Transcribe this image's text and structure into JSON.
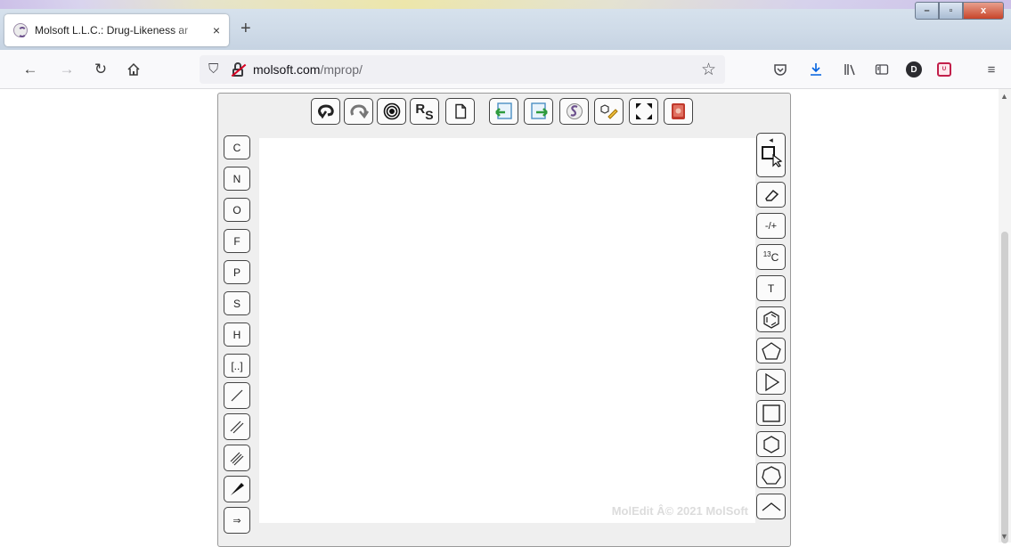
{
  "browser": {
    "tab_title": "Molsoft L.L.C.: Drug-Likeness ar",
    "tab_close": "×",
    "new_tab": "+",
    "url_host": "molsoft.com",
    "url_path": "/mprop/",
    "profile_initial": "D",
    "window_controls": {
      "minimize": "–",
      "maximize": "▫",
      "close": "x"
    }
  },
  "editor": {
    "copyright": "MolEdit Â© 2021 MolSoft",
    "top_toolbar": [
      {
        "name": "undo",
        "icon": "undo-icon"
      },
      {
        "name": "redo",
        "icon": "redo-icon"
      },
      {
        "name": "center",
        "icon": "target-icon"
      },
      {
        "name": "stereo",
        "icon": "rs-icon",
        "label": "RS"
      },
      {
        "name": "new",
        "icon": "document-icon"
      },
      {
        "name": "import",
        "icon": "import-icon"
      },
      {
        "name": "export",
        "icon": "export-icon"
      },
      {
        "name": "molsoft",
        "icon": "molsoft-logo-icon"
      },
      {
        "name": "clean",
        "icon": "clean-structure-icon"
      },
      {
        "name": "fullscreen",
        "icon": "fullscreen-icon"
      },
      {
        "name": "help",
        "icon": "book-icon"
      }
    ],
    "atoms": [
      "C",
      "N",
      "O",
      "F",
      "P",
      "S",
      "H",
      "[..]"
    ],
    "bond_tools": [
      "single-bond-icon",
      "double-bond-icon",
      "triple-bond-icon",
      "wedge-bond-icon",
      "arrow-icon"
    ],
    "arrow_label": "⇒",
    "right_tools": {
      "collapse": "◂",
      "charge": "-/+",
      "isotope_mass": "13",
      "isotope_atom": "C",
      "text": "T"
    }
  }
}
